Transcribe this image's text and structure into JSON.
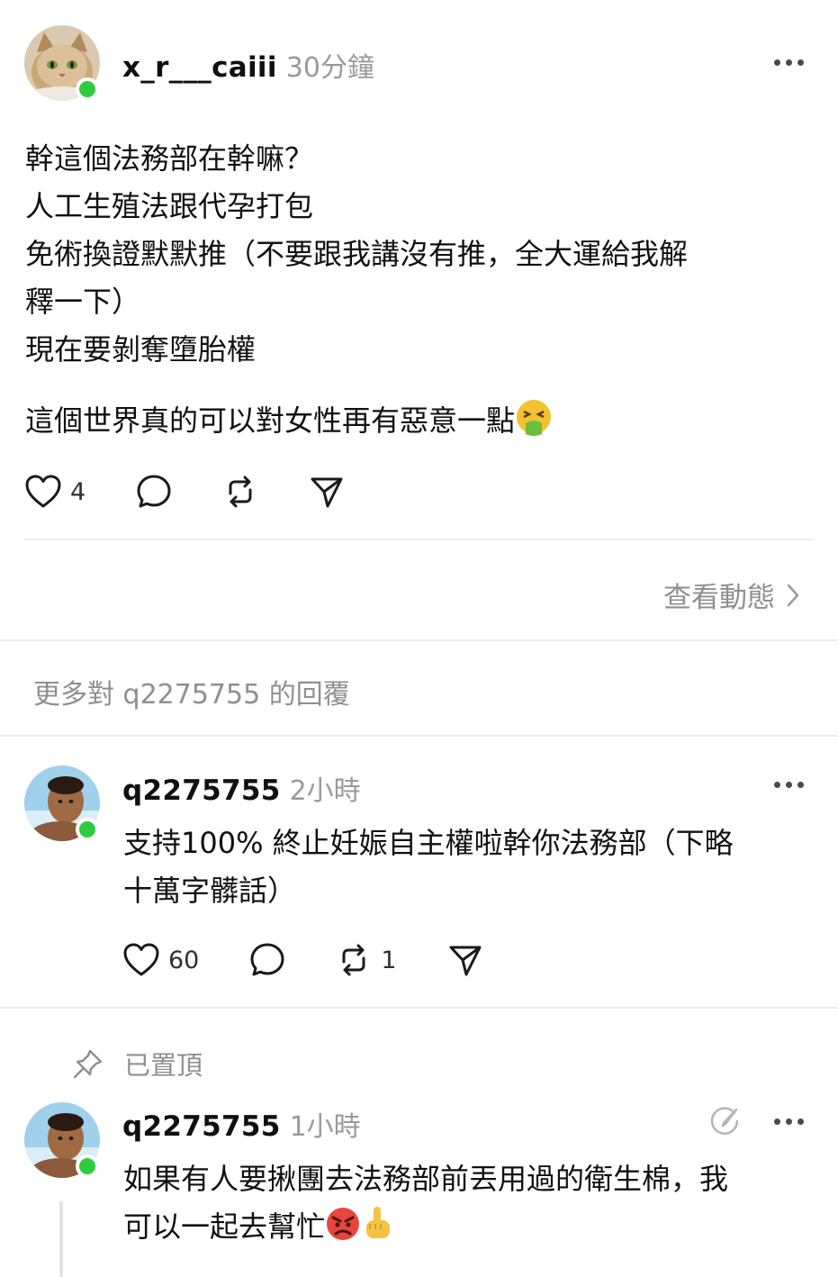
{
  "post": {
    "username": "x_r___caiii",
    "time": "30分鐘",
    "lines": [
      "幹這個法務部在幹嘛？",
      "人工生殖法跟代孕打包",
      "免術換證默默推（不要跟我講沒有推，全大運給我解",
      "釋一下）",
      "現在要剝奪墮胎權"
    ],
    "closing_line": "這個世界真的可以對女性再有惡意一點",
    "likes": "4"
  },
  "view_activity_label": "查看動態",
  "more_replies_header": "更多對 q2275755 的回覆",
  "reply1": {
    "username": "q2275755",
    "time": "2小時",
    "lines": [
      "支持100% 終止妊娠自主權啦幹你法務部（下略",
      "十萬字髒話）"
    ],
    "likes": "60",
    "reposts": "1"
  },
  "pinned_label": "已置頂",
  "reply2": {
    "username": "q2275755",
    "time": "1小時",
    "lines": [
      "如果有人要揪團去法務部前丟用過的衛生棉，我",
      "可以一起去幫忙"
    ]
  },
  "icons": {
    "like": "heart-icon",
    "comment": "comment-bubble-icon",
    "repost": "repost-icon",
    "share": "send-icon",
    "more": "more-dots-icon",
    "pin": "pin-icon",
    "edit": "edit-circle-icon",
    "chevron": "chevron-right-icon"
  },
  "colors": {
    "online": "#2ecc40",
    "muted_text": "#9a9a9a",
    "divider": "#eeeeee"
  }
}
